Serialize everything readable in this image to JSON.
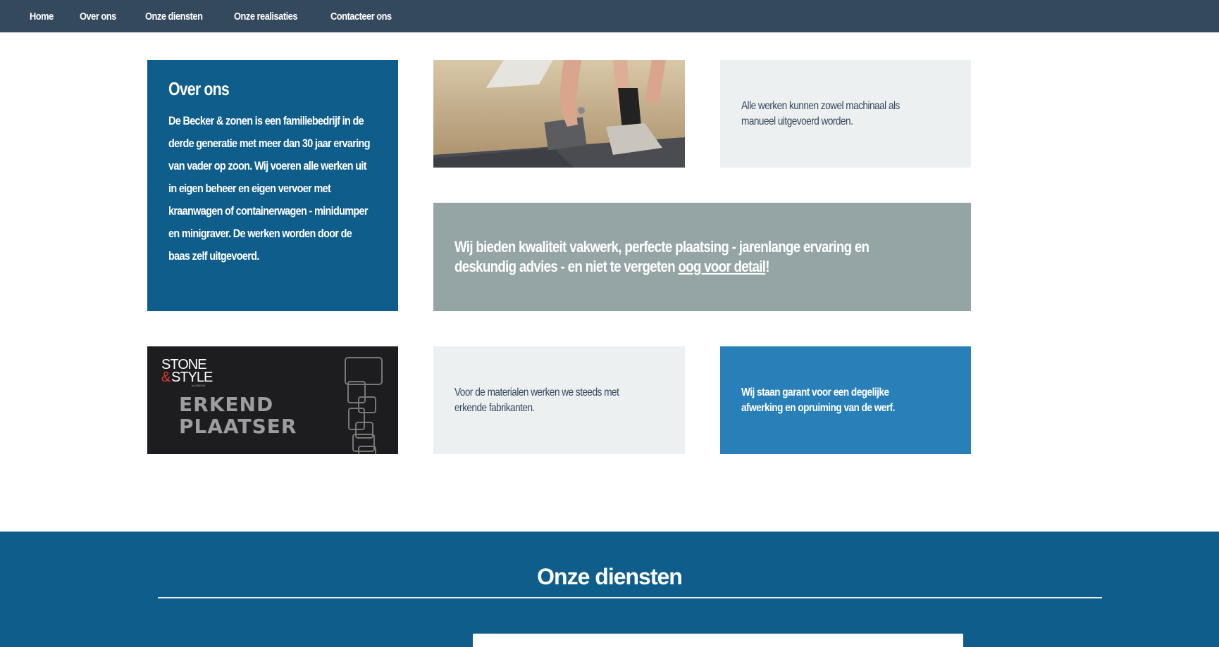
{
  "nav": {
    "items": [
      "Home",
      "Over ons",
      "Onze diensten",
      "Onze realisaties",
      "Contacteer ons"
    ]
  },
  "about": {
    "title": "Over ons",
    "text": "De Becker & zonen is een familiebedrijf in de derde generatie met meer dan 30 jaar ervaring van vader op zoon. Wij voeren alle werken uit in eigen beheer en eigen vervoer met kraanwagen of containerwagen - minidumper en minigraver. De werken worden door de baas zelf uitgevoerd."
  },
  "tiles": {
    "machine_text": "Alle werken kunnen zowel machinaal als manueel uitgevoerd worden.",
    "quote_before": "Wij bieden kwaliteit vakwerk, perfecte plaatsing - jarenlange ervaring en deskundig advies - en niet te vergeten ",
    "quote_link": "oog voor detail",
    "quote_after": "!",
    "materials_text": "Voor de materialen werken we steeds met erkende fabrikanten.",
    "guarantee_text": "Wij staan garant voor een degelijke afwerking en opruiming van de werf."
  },
  "logo": {
    "brand_line1": "STONE",
    "brand_amp": "&",
    "brand_line2": "STYLE",
    "brand_by": "by EBEMA",
    "text_line1": "ERKEND",
    "text_line2": "PLAATSER"
  },
  "services": {
    "title": "Onze diensten"
  },
  "colors": {
    "nav_bg": "#34495e",
    "primary_blue": "#0e5d8a",
    "accent_blue": "#2980b9",
    "light_gray": "#ecf0f1",
    "slate_gray": "#95a5a6"
  }
}
